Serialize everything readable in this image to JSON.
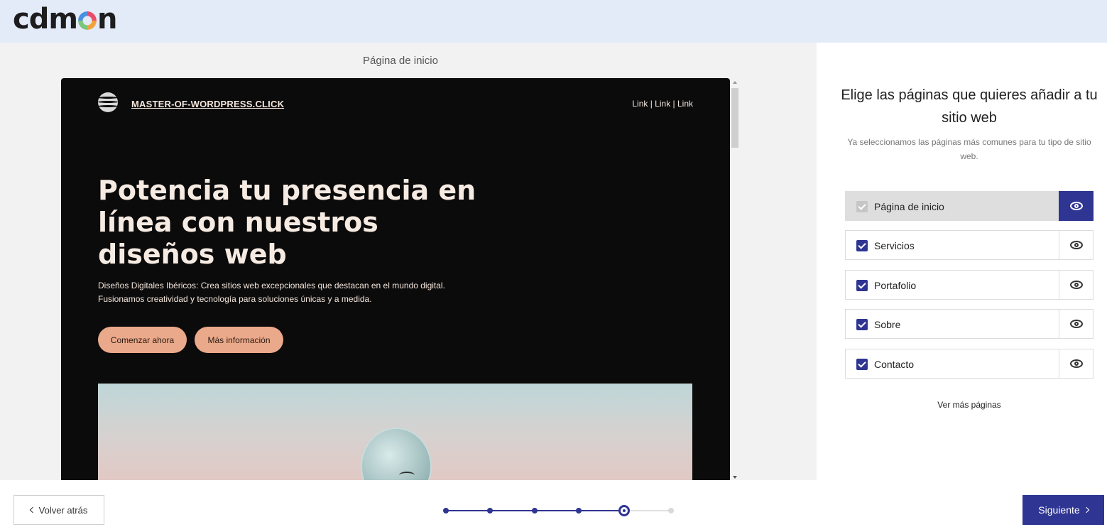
{
  "brand": {
    "logo_text_a": "cdm",
    "logo_text_b": "n"
  },
  "preview": {
    "title": "Página de inicio",
    "site_name": "MASTER-OF-WORDPRESS.CLICK",
    "links": "Link | Link | Link",
    "hero_title": "Potencia tu presencia en línea con nuestros diseños web",
    "hero_desc_line1": "Diseños Digitales Ibéricos: Crea sitios web excepcionales que destacan en el mundo digital.",
    "hero_desc_line2": "Fusionamos creatividad y tecnología para soluciones únicas y a medida.",
    "primary_button": "Comenzar ahora",
    "secondary_button": "Más información"
  },
  "panel": {
    "title": "Elige las páginas que quieres añadir a tu sitio web",
    "subtitle": "Ya seleccionamos las páginas más comunes para tu tipo de sitio web.",
    "pages": [
      {
        "label": "Página de inicio",
        "checked": true,
        "locked": true
      },
      {
        "label": "Servicios",
        "checked": true,
        "locked": false
      },
      {
        "label": "Portafolio",
        "checked": true,
        "locked": false
      },
      {
        "label": "Sobre",
        "checked": true,
        "locked": false
      },
      {
        "label": "Contacto",
        "checked": true,
        "locked": false
      }
    ],
    "more_link": "Ver más páginas"
  },
  "footer": {
    "back_label": "Volver atrás",
    "next_label": "Siguiente",
    "steps_total": 6,
    "current_step": 5
  },
  "colors": {
    "accent": "#2f3592",
    "header_bg": "#e3eaf8",
    "hero_button": "#eaa98a"
  }
}
